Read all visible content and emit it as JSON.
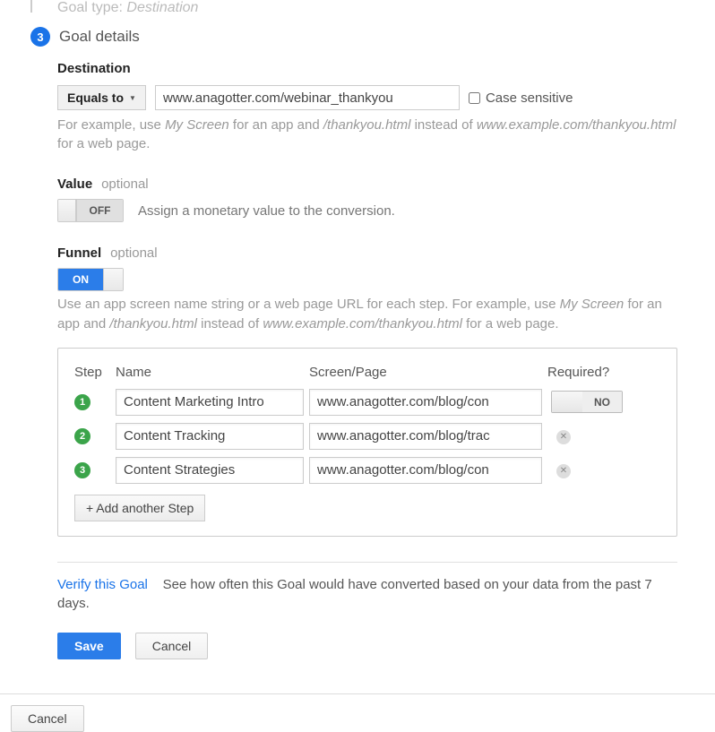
{
  "prev_step": {
    "label": "Goal type:",
    "value": "Destination"
  },
  "step": {
    "number": "3",
    "title": "Goal details"
  },
  "destination": {
    "heading": "Destination",
    "match_dropdown": "Equals to",
    "url": "www.anagotter.com/webinar_thankyou",
    "case_sensitive_label": "Case sensitive",
    "hint_pre": "For example, use ",
    "hint_app": "My Screen",
    "hint_mid1": " for an app and ",
    "hint_path": "/thankyou.html",
    "hint_mid2": " instead of ",
    "hint_full": "www.example.com/thankyou.html",
    "hint_post": " for a web page."
  },
  "value": {
    "label": "Value",
    "optional": "optional",
    "toggle": "OFF",
    "desc": "Assign a monetary value to the conversion."
  },
  "funnel": {
    "label": "Funnel",
    "optional": "optional",
    "toggle": "ON",
    "hint_pre": "Use an app screen name string or a web page URL for each step. For example, use ",
    "hint_app": "My Screen",
    "hint_mid1": " for an app and ",
    "hint_path": "/thankyou.html",
    "hint_mid2": " instead of ",
    "hint_full": "www.example.com/thankyou.html",
    "hint_post": " for a web page."
  },
  "funnel_table": {
    "head_step": "Step",
    "head_name": "Name",
    "head_page": "Screen/Page",
    "head_required": "Required?",
    "rows": [
      {
        "num": "1",
        "name": "Content Marketing Intro",
        "page": "www.anagotter.com/blog/con"
      },
      {
        "num": "2",
        "name": "Content Tracking",
        "page": "www.anagotter.com/blog/trac"
      },
      {
        "num": "3",
        "name": "Content Strategies",
        "page": "www.anagotter.com/blog/con"
      }
    ],
    "required_toggle": "NO",
    "add_step": "+ Add another Step"
  },
  "verify": {
    "link": "Verify this Goal",
    "text": "See how often this Goal would have converted based on your data from the past 7 days."
  },
  "buttons": {
    "save": "Save",
    "cancel": "Cancel"
  },
  "outer_cancel": "Cancel"
}
